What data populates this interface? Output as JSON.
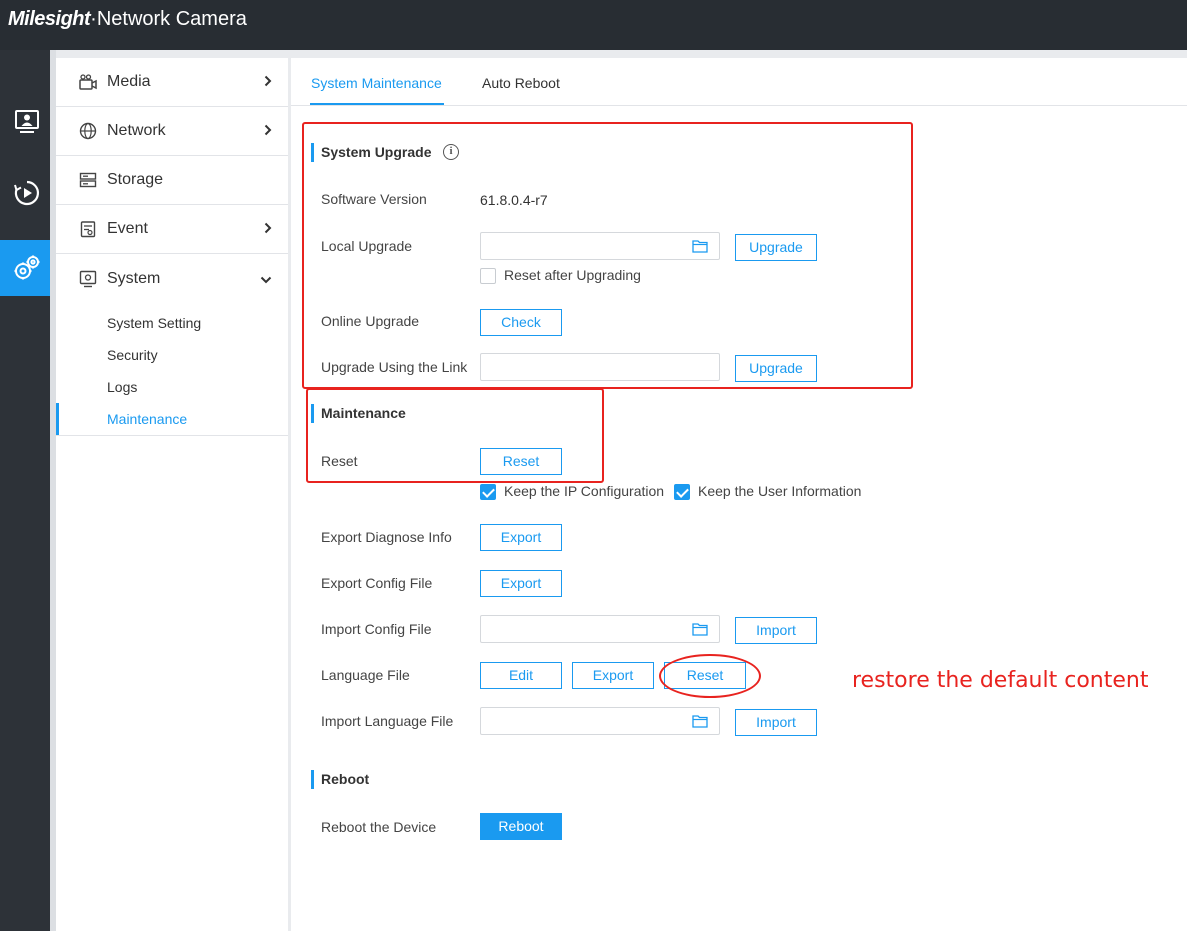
{
  "header": {
    "logo_text": "Milesight",
    "product_title": "·Network Camera"
  },
  "rail": {
    "items": [
      {
        "icon": "live-view-icon",
        "active": false
      },
      {
        "icon": "playback-icon",
        "active": false
      },
      {
        "icon": "settings-icon",
        "active": true
      }
    ]
  },
  "sidebar": {
    "items": [
      {
        "label": "Media",
        "icon": "camera-icon",
        "expandable": true
      },
      {
        "label": "Network",
        "icon": "globe-icon",
        "expandable": true
      },
      {
        "label": "Storage",
        "icon": "storage-icon",
        "expandable": false
      },
      {
        "label": "Event",
        "icon": "event-icon",
        "expandable": true
      },
      {
        "label": "System",
        "icon": "system-icon",
        "expandable": true,
        "expanded": true
      }
    ],
    "system_submenu": [
      {
        "label": "System Setting",
        "active": false
      },
      {
        "label": "Security",
        "active": false
      },
      {
        "label": "Logs",
        "active": false
      },
      {
        "label": "Maintenance",
        "active": true
      }
    ]
  },
  "tabs": [
    {
      "label": "System Maintenance",
      "active": true
    },
    {
      "label": "Auto Reboot",
      "active": false
    }
  ],
  "system_upgrade": {
    "title": "System Upgrade",
    "software_version_label": "Software Version",
    "software_version_value": "61.8.0.4-r7",
    "local_upgrade_label": "Local Upgrade",
    "local_upgrade_button": "Upgrade",
    "reset_after_upgrading_label": "Reset after Upgrading",
    "reset_after_upgrading_checked": false,
    "online_upgrade_label": "Online Upgrade",
    "check_button": "Check",
    "upgrade_link_label": "Upgrade Using the Link",
    "upgrade_link_button": "Upgrade"
  },
  "maintenance": {
    "title": "Maintenance",
    "reset_label": "Reset",
    "reset_button": "Reset",
    "keep_ip_label": "Keep the IP Configuration",
    "keep_ip_checked": true,
    "keep_user_label": "Keep the User Information",
    "keep_user_checked": true,
    "export_diagnose_label": "Export Diagnose Info",
    "export_diagnose_button": "Export",
    "export_config_label": "Export Config File",
    "export_config_button": "Export",
    "import_config_label": "Import Config File",
    "import_config_button": "Import",
    "language_file_label": "Language File",
    "language_edit_button": "Edit",
    "language_export_button": "Export",
    "language_reset_button": "Reset",
    "import_language_label": "Import Language File",
    "import_language_button": "Import"
  },
  "reboot": {
    "title": "Reboot",
    "reboot_device_label": "Reboot the Device",
    "reboot_button": "Reboot"
  },
  "annotation": {
    "note": "restore the default content",
    "color": "#e8231f"
  },
  "colors": {
    "accent": "#1a9af0",
    "topbar": "#282d33",
    "rail": "#2d3238"
  }
}
